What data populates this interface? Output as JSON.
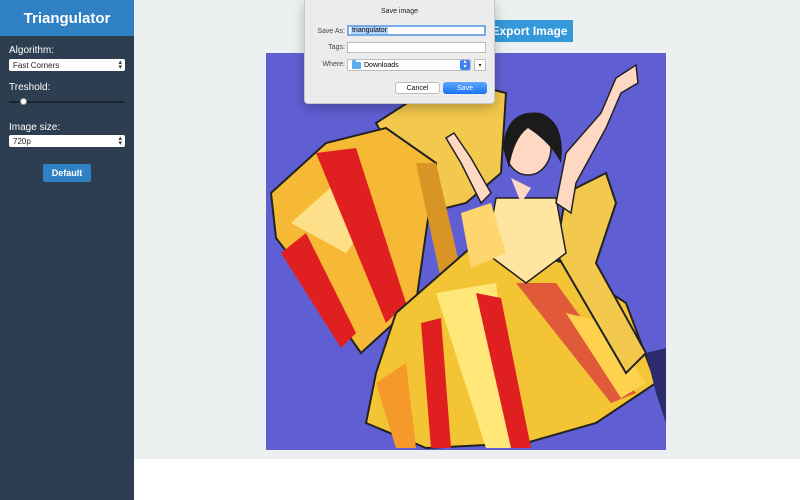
{
  "app": {
    "title": "Triangulator"
  },
  "sidebar": {
    "algorithm_label": "Algorithm:",
    "algorithm_value": "Fast Corners",
    "threshold_label": "Treshold:",
    "threshold_value": 0.1,
    "image_size_label": "Image size:",
    "image_size_value": "720p",
    "default_button": "Default"
  },
  "main": {
    "export_button": "Export Image"
  },
  "dialog": {
    "title": "Save image",
    "save_as_label": "Save As:",
    "save_as_value": "triangulator",
    "tags_label": "Tags:",
    "tags_value": "",
    "where_label": "Where:",
    "where_value": "Downloads",
    "cancel_button": "Cancel",
    "save_button": "Save"
  },
  "icons": {
    "select_chevron": "chevron-updown-icon",
    "folder": "folder-icon",
    "expand": "chevron-down-icon"
  },
  "colors": {
    "sidebar_bg": "#2c3e50",
    "header_bg": "#2f81c3",
    "accent": "#3498db",
    "canvas_bg": "#5f5fd3"
  }
}
